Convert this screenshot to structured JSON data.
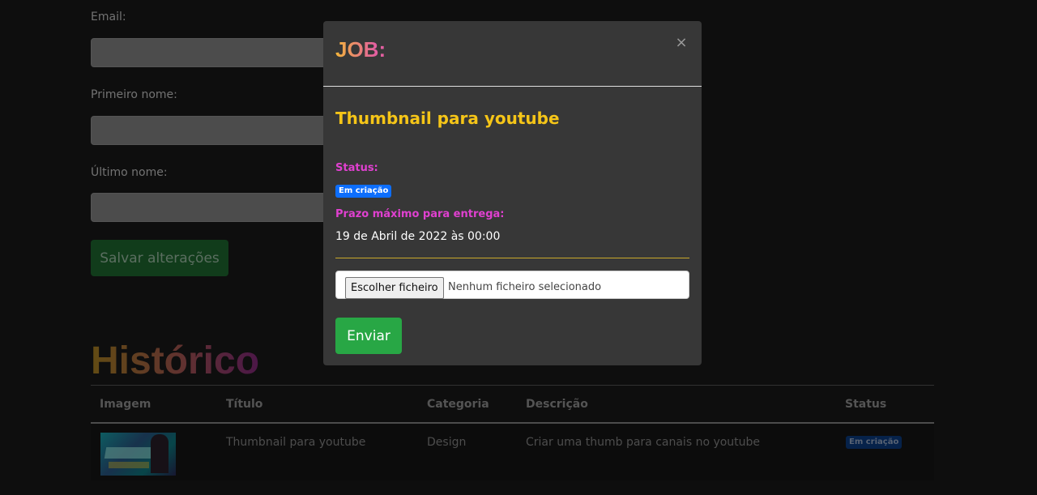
{
  "form": {
    "email_label": "Email:",
    "first_name_label": "Primeiro nome:",
    "last_name_label": "Último nome:",
    "save_label": "Salvar alterações"
  },
  "history": {
    "title": "Histórico",
    "columns": [
      "Imagem",
      "Título",
      "Categoria",
      "Descrição",
      "Status"
    ],
    "rows": [
      {
        "title": "Thumbnail para youtube",
        "category": "Design",
        "description": "Criar uma thumb para canais no youtube",
        "status": "Em criação"
      }
    ]
  },
  "modal": {
    "title": "JOB:",
    "close_icon": "×",
    "job_name": "Thumbnail para youtube",
    "status_label": "Status:",
    "status_value": "Em criação",
    "deadline_label": "Prazo máximo para entrega:",
    "deadline_value": "19 de Abril de 2022 às 00:00",
    "file_button": "Escolher ficheiro",
    "file_status": "Nenhum ficheiro selecionado",
    "submit_label": "Enviar"
  },
  "colors": {
    "accent_yellow": "#f5c518",
    "accent_pink": "#e040d0",
    "success_green": "#28a745",
    "badge_blue": "#0d6efd"
  }
}
